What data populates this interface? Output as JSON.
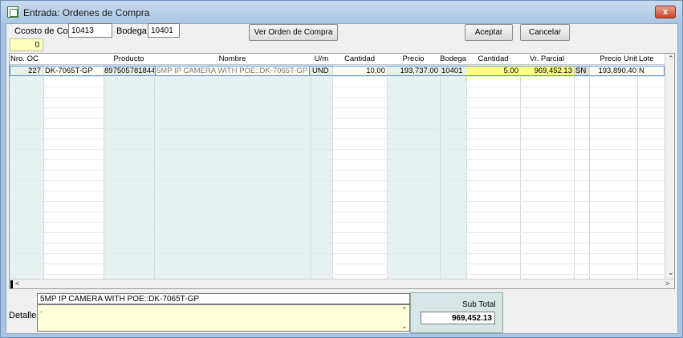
{
  "window": {
    "title": "Entrada: Ordenes de Compra",
    "close_label": "x"
  },
  "header": {
    "costo_label": "Ccosto de Costo :",
    "costo_value": "10413",
    "bodega_label": "Bodega :",
    "bodega_value": "10401",
    "counter_value": "0",
    "ver_orden_label": "Ver Orden de Compra",
    "aceptar_label": "Aceptar",
    "cancelar_label": "Cancelar"
  },
  "grid": {
    "columns": [
      "Nro. OC",
      "Producto",
      "Nombre",
      "U/m",
      "Cantidad",
      "Precio",
      "Bodega",
      "Cantidad",
      "Vr. Parcial",
      "Precio Unit",
      "Lote"
    ],
    "row": {
      "nro_oc": "227",
      "codigo": "DK-7065T-GP",
      "producto": "8975057818­44",
      "nombre": "5MP IP CAMERA WITH POE::DK-7065T-GP",
      "um": "UND",
      "cantidad": "10.00",
      "precio": "193,737.00",
      "bodega": "10401",
      "cantidad2": "5.00",
      "vr_parcial": "969,452.13",
      "sn": "SN",
      "precio_unit": "193,890.40",
      "lote": "N"
    }
  },
  "footer": {
    "detalle_label": "Detalle",
    "detalle_title": "5MP IP CAMERA WITH POE::DK-7065T-GP",
    "detalle_text": ".",
    "subtotal_label": "Sub Total",
    "subtotal_value": "969,452.13"
  },
  "colors": {
    "highlight_yellow": "#ffff80",
    "row_tint": "#e6f2f2",
    "selection": "#5b8ed6"
  }
}
